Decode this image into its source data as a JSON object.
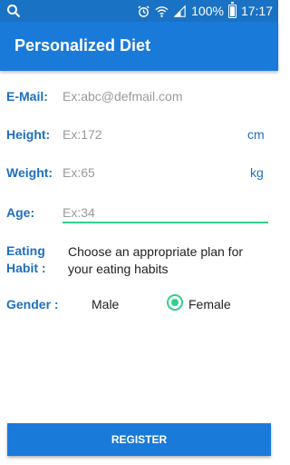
{
  "status_bar": {
    "battery": "100%",
    "time": "17:17",
    "icons": [
      "search-icon",
      "alarm-icon",
      "wifi-icon",
      "signal-icon",
      "battery-icon"
    ]
  },
  "app_bar": {
    "title": "Personalized Diet"
  },
  "form": {
    "email": {
      "label": "E-Mail:",
      "placeholder": "Ex:abc@defmail.com"
    },
    "height": {
      "label": "Height:",
      "placeholder": "Ex:172",
      "unit": "cm"
    },
    "weight": {
      "label": "Weight:",
      "placeholder": "Ex:65",
      "unit": "kg"
    },
    "age": {
      "label": "Age:",
      "placeholder": "Ex:34"
    },
    "eating_habit": {
      "label_line1": "Eating",
      "label_line2": "Habit :",
      "value": "Choose an appropriate plan for your eating habits"
    },
    "gender": {
      "label": "Gender :",
      "options": [
        "Male",
        "Female"
      ],
      "selected": "Female"
    }
  },
  "register_label": "REGISTER",
  "colors": {
    "primary": "#1a7ad9",
    "accent": "#2fd08f",
    "label": "#1e6fbf"
  }
}
